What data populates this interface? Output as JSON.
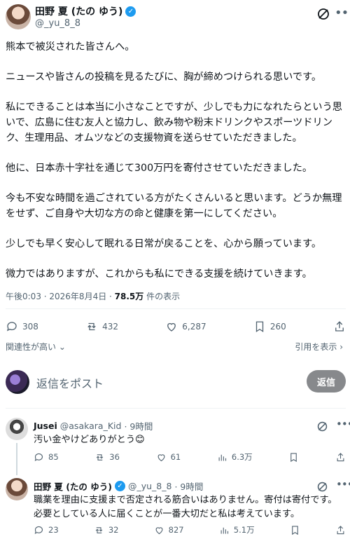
{
  "post": {
    "author_name": "田野 夏 (たの ゆう)",
    "author_handle": "@_yu_8_8",
    "paragraphs": [
      "熊本で被災された皆さんへ。",
      "ニュースや皆さんの投稿を見るたびに、胸が締めつけられる思いです。",
      "私にできることは本当に小さなことですが、少しでも力になれたらという思いで、広島に住む友人と協力し、飲み物や粉末ドリンクやスポーツドリンク、生理用品、オムツなどの支援物資を送らせていただきました。",
      "他に、日本赤十字社を通じて300万円を寄付させていただきました。",
      "今も不安な時間を過ごされている方がたくさんいると思います。どうか無理をせず、ご自身や大切な方の命と健康を第一にしてください。",
      "少しでも早く安心して眠れる日常が戻ることを、心から願っています。",
      "微力ではありますが、これからも私にできる支援を続けていきます。"
    ],
    "meta_time": "午後0:03 · 2026年8月4日 · ",
    "meta_views": "78.5万",
    "meta_views_suffix": " 件の表示",
    "actions": {
      "replies": "308",
      "reposts": "432",
      "likes": "6,287",
      "bookmarks": "260"
    },
    "sort_label": "関連性が高い",
    "quotes_label": "引用を表示"
  },
  "reply_box": {
    "placeholder": "返信をポスト",
    "button": "返信"
  },
  "comments": [
    {
      "name": "Jusei",
      "handle": "@asakara_Kid",
      "time": "· 9時間",
      "text": "汚い金やけどありがとう😊",
      "replies": "85",
      "reposts": "36",
      "likes": "61",
      "views": "6.3万"
    },
    {
      "name": "田野 夏 (たの ゆう)",
      "handle": "@_yu_8_8",
      "time": "· 9時間",
      "text": "職業を理由に支援まで否定される筋合いはありません。寄付は寄付です。必要としている人に届くことが一番大切だと私は考えています。",
      "replies": "23",
      "reposts": "32",
      "likes": "827",
      "views": "5.1万"
    }
  ],
  "colors": {
    "accent": "#1d9bf0",
    "muted": "#536471",
    "reply_button": "#87898c"
  }
}
